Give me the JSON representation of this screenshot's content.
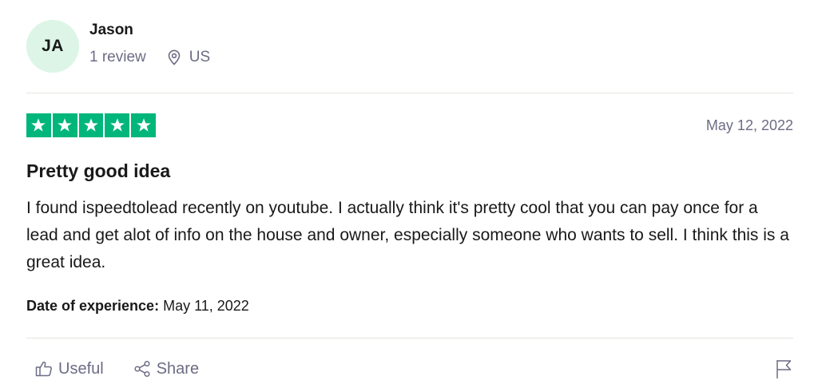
{
  "reviewer": {
    "initials": "JA",
    "name": "Jason",
    "review_count": "1 review",
    "location": "US",
    "avatar_color": "#dcf5e7"
  },
  "rating": {
    "stars": 5,
    "max_stars": 5,
    "star_color": "#00b67a",
    "icon": "star-icon"
  },
  "review": {
    "date": "May 12, 2022",
    "title": "Pretty good idea",
    "body": "I found ispeedtolead recently on youtube. I actually think it's pretty cool that you can pay once for a lead and get alot of info on the house and owner, especially someone who wants to sell. I think this is a great idea.",
    "experience_label": "Date of experience:",
    "experience_date": "May 11, 2022"
  },
  "actions": {
    "useful_label": "Useful",
    "useful_icon": "thumbs-up-icon",
    "share_label": "Share",
    "share_icon": "share-icon",
    "flag_icon": "flag-icon"
  },
  "colors": {
    "text_primary": "#191919",
    "text_secondary": "#6c6c85",
    "divider": "#e5e5dd"
  }
}
